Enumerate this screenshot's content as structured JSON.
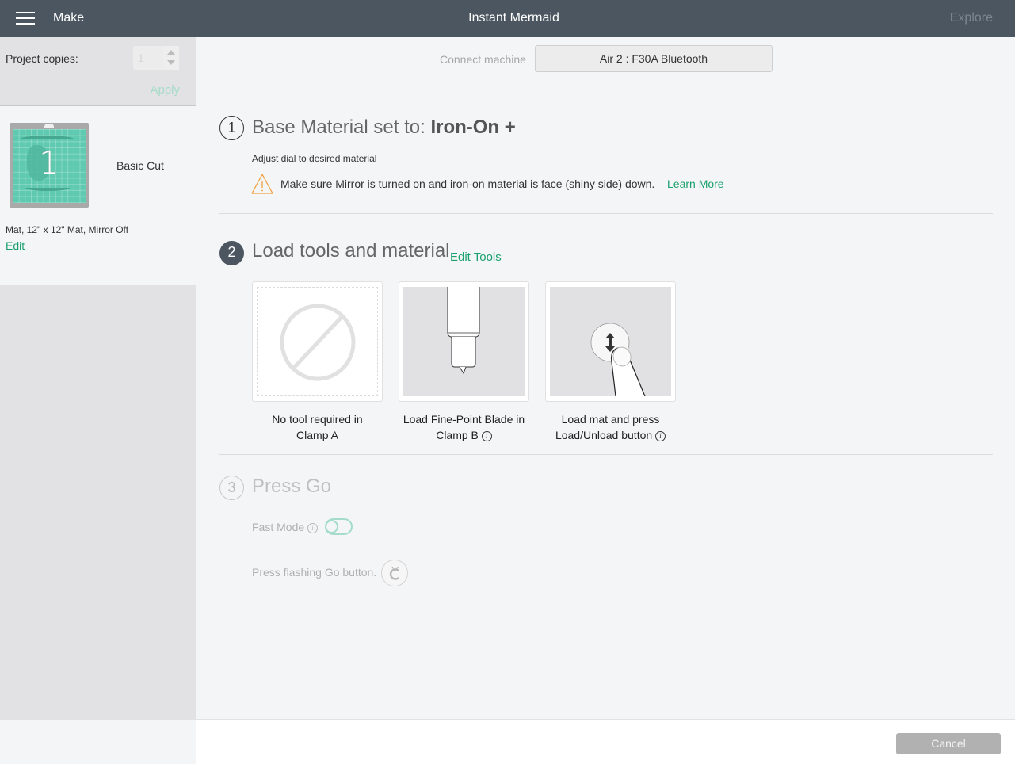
{
  "topbar": {
    "menu_icon": "hamburger-menu-icon",
    "section": "Make",
    "title": "Instant Mermaid",
    "explore_label": "Explore"
  },
  "sidebar": {
    "copies_label": "Project copies:",
    "copies_value": "1",
    "apply_label": "Apply",
    "mat": {
      "number": "1",
      "cut_type": "Basic Cut",
      "info": "Mat, 12\" x 12\" Mat, Mirror Off",
      "edit_label": "Edit"
    }
  },
  "connect": {
    "label": "Connect machine",
    "machine": "Air 2 : F30A Bluetooth"
  },
  "step1": {
    "number": "1",
    "title_prefix": "Base Material set to: ",
    "material": "Iron-On +",
    "adjust_text": "Adjust dial to desired material",
    "warning_icon": "warning-triangle-icon",
    "warning_text": "Make sure Mirror is turned on and iron-on material is face (shiny side) down.",
    "learn_more_label": "Learn More"
  },
  "step2": {
    "number": "2",
    "title": "Load tools and material",
    "edit_tools_label": "Edit Tools",
    "cards": [
      {
        "icon": "no-tool-icon",
        "line1": "No tool required in",
        "line2": "Clamp A",
        "has_info": false
      },
      {
        "icon": "fine-point-blade-icon",
        "line1": "Load Fine-Point Blade in",
        "line2": "Clamp B",
        "has_info": true
      },
      {
        "icon": "load-unload-button-icon",
        "line1": "Load mat and press",
        "line2": "Load/Unload button",
        "has_info": true
      }
    ]
  },
  "step3": {
    "number": "3",
    "title": "Press Go",
    "fast_mode_label": "Fast Mode",
    "fast_mode_on": false,
    "press_go_text": "Press flashing Go button.",
    "go_icon": "cricut-go-icon"
  },
  "footer": {
    "cancel_label": "Cancel"
  },
  "colors": {
    "topbar": "#4b5660",
    "accent_green": "#1aa06d",
    "warning_orange": "#f0a040",
    "mat_green": "#5fcab0"
  }
}
